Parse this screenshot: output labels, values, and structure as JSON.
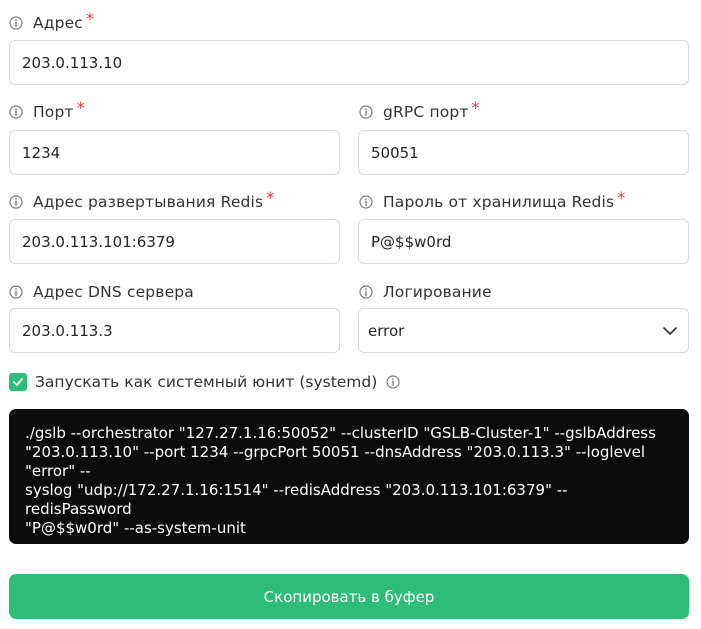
{
  "fields": {
    "address": {
      "label": "Адрес",
      "required": "*",
      "value": "203.0.113.10"
    },
    "port": {
      "label": "Порт",
      "required": "*",
      "value": "1234"
    },
    "grpc_port": {
      "label": "gRPC порт",
      "required": "*",
      "value": "50051"
    },
    "redis_address": {
      "label": "Адрес развертывания Redis",
      "required": "*",
      "value": "203.0.113.101:6379"
    },
    "redis_password": {
      "label": "Пароль от хранилища Redis",
      "required": "*",
      "value": "P@$$w0rd"
    },
    "dns_address": {
      "label": "Адрес DNS сервера",
      "value": "203.0.113.3"
    },
    "logging": {
      "label": "Логирование",
      "value": "error"
    }
  },
  "systemd": {
    "label": "Запускать как системный юнит (systemd)",
    "checked": true
  },
  "command": "./gslb --orchestrator \"127.27.1.16:50052\" --clusterID \"GSLB-Cluster-1\" --gslbAddress\n\"203.0.113.10\" --port 1234 --grpcPort 50051 --dnsAddress \"203.0.113.3\" --loglevel \"error\" --\nsyslog \"udp://172.27.1.16:1514\" --redisAddress \"203.0.113.101:6379\" --redisPassword\n\"P@$$w0rd\" --as-system-unit",
  "copy_button": {
    "label": "Скопировать в буфер"
  },
  "icons": {
    "info": "info-circle-icon",
    "chevron": "chevron-down-icon",
    "check": "check-icon"
  },
  "colors": {
    "accent": "#2ebd77",
    "required": "#e53935",
    "terminal_bg": "#0c0c0c",
    "border": "#d9d9d9"
  }
}
